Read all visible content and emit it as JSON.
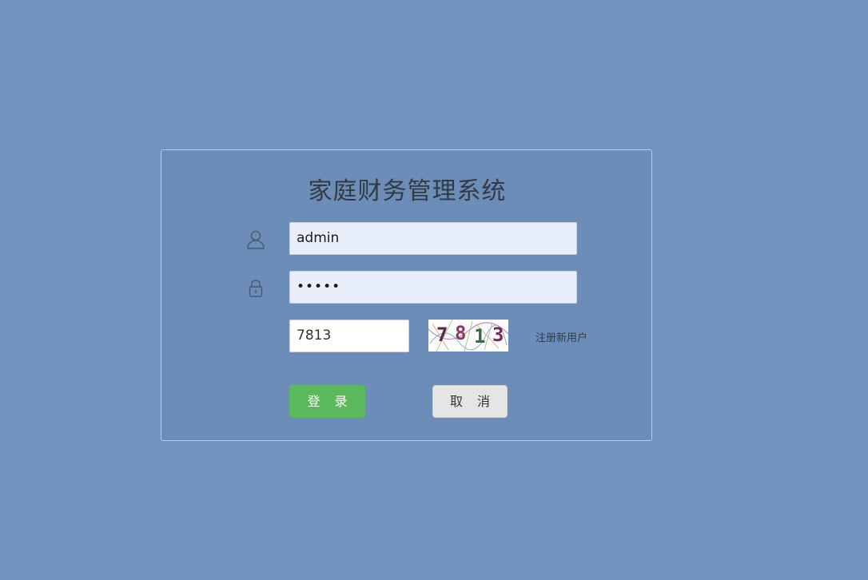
{
  "app": {
    "title": "家庭财务管理系统"
  },
  "form": {
    "username": {
      "value": "admin",
      "icon": "user-icon"
    },
    "password": {
      "value": "•••••",
      "icon": "lock-icon"
    },
    "captcha": {
      "value": "7813",
      "image_text": [
        "7",
        "8",
        "1",
        "3"
      ]
    },
    "register_label": "注册新用户"
  },
  "buttons": {
    "login_label": "登录",
    "cancel_label": "取消"
  },
  "colors": {
    "background": "#7093c0",
    "panel": "#6b8db7",
    "panel_border": "#a9d0f2",
    "login_button": "#5cb85c",
    "cancel_button": "#e5e5e5"
  }
}
